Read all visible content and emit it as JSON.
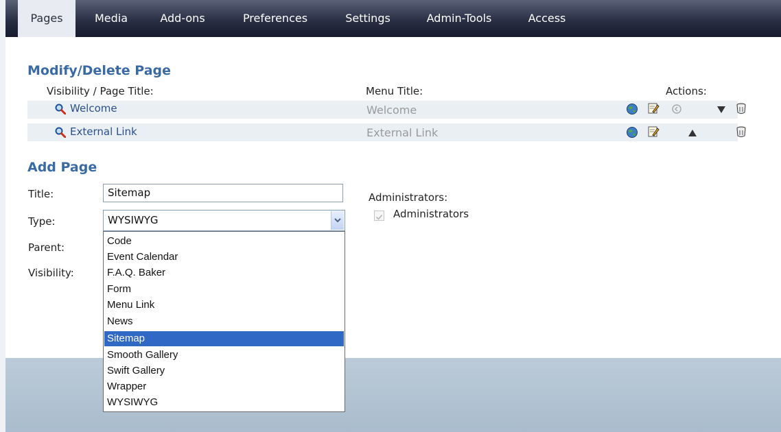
{
  "nav": {
    "tabs": [
      {
        "label": "Pages",
        "active": true
      },
      {
        "label": "Media",
        "active": false
      },
      {
        "label": "Add-ons",
        "active": false
      },
      {
        "label": "Preferences",
        "active": false
      },
      {
        "label": "Settings",
        "active": false
      },
      {
        "label": "Admin-Tools",
        "active": false
      },
      {
        "label": "Access",
        "active": false
      }
    ]
  },
  "modify": {
    "title": "Modify/Delete Page",
    "col_page_title": "Visibility / Page Title:",
    "col_menu_title": "Menu Title:",
    "col_actions": "Actions:",
    "rows": [
      {
        "page_title": "Welcome",
        "menu_title": "Welcome"
      },
      {
        "page_title": "External Link",
        "menu_title": "External Link"
      }
    ]
  },
  "add_page": {
    "title": "Add Page",
    "title_label": "Title:",
    "title_value": "Sitemap",
    "type_label": "Type:",
    "type_value": "WYSIWYG",
    "parent_label": "Parent:",
    "visibility_label": "Visibility:",
    "admins_label": "Administrators:",
    "admins_checkbox_label": "Administrators",
    "admins_checked": true
  },
  "type_options": [
    "Code",
    "Event Calendar",
    "F.A.Q. Baker",
    "Form",
    "Menu Link",
    "News",
    "Sitemap",
    "Smooth Gallery",
    "Swift Gallery",
    "Wrapper",
    "WYSIWYG"
  ],
  "type_highlighted": "Sitemap",
  "colors": {
    "accent": "#3a6aa4",
    "link": "#2a4f8a",
    "highlight": "#3068c6",
    "nav_dark": "#1c2033"
  },
  "icons": [
    "magnifier-icon",
    "view-globe-icon",
    "edit-icon",
    "restore-icon",
    "move-down-icon",
    "move-up-icon",
    "delete-icon",
    "dropdown-arrow-icon",
    "checkbox-icon"
  ]
}
